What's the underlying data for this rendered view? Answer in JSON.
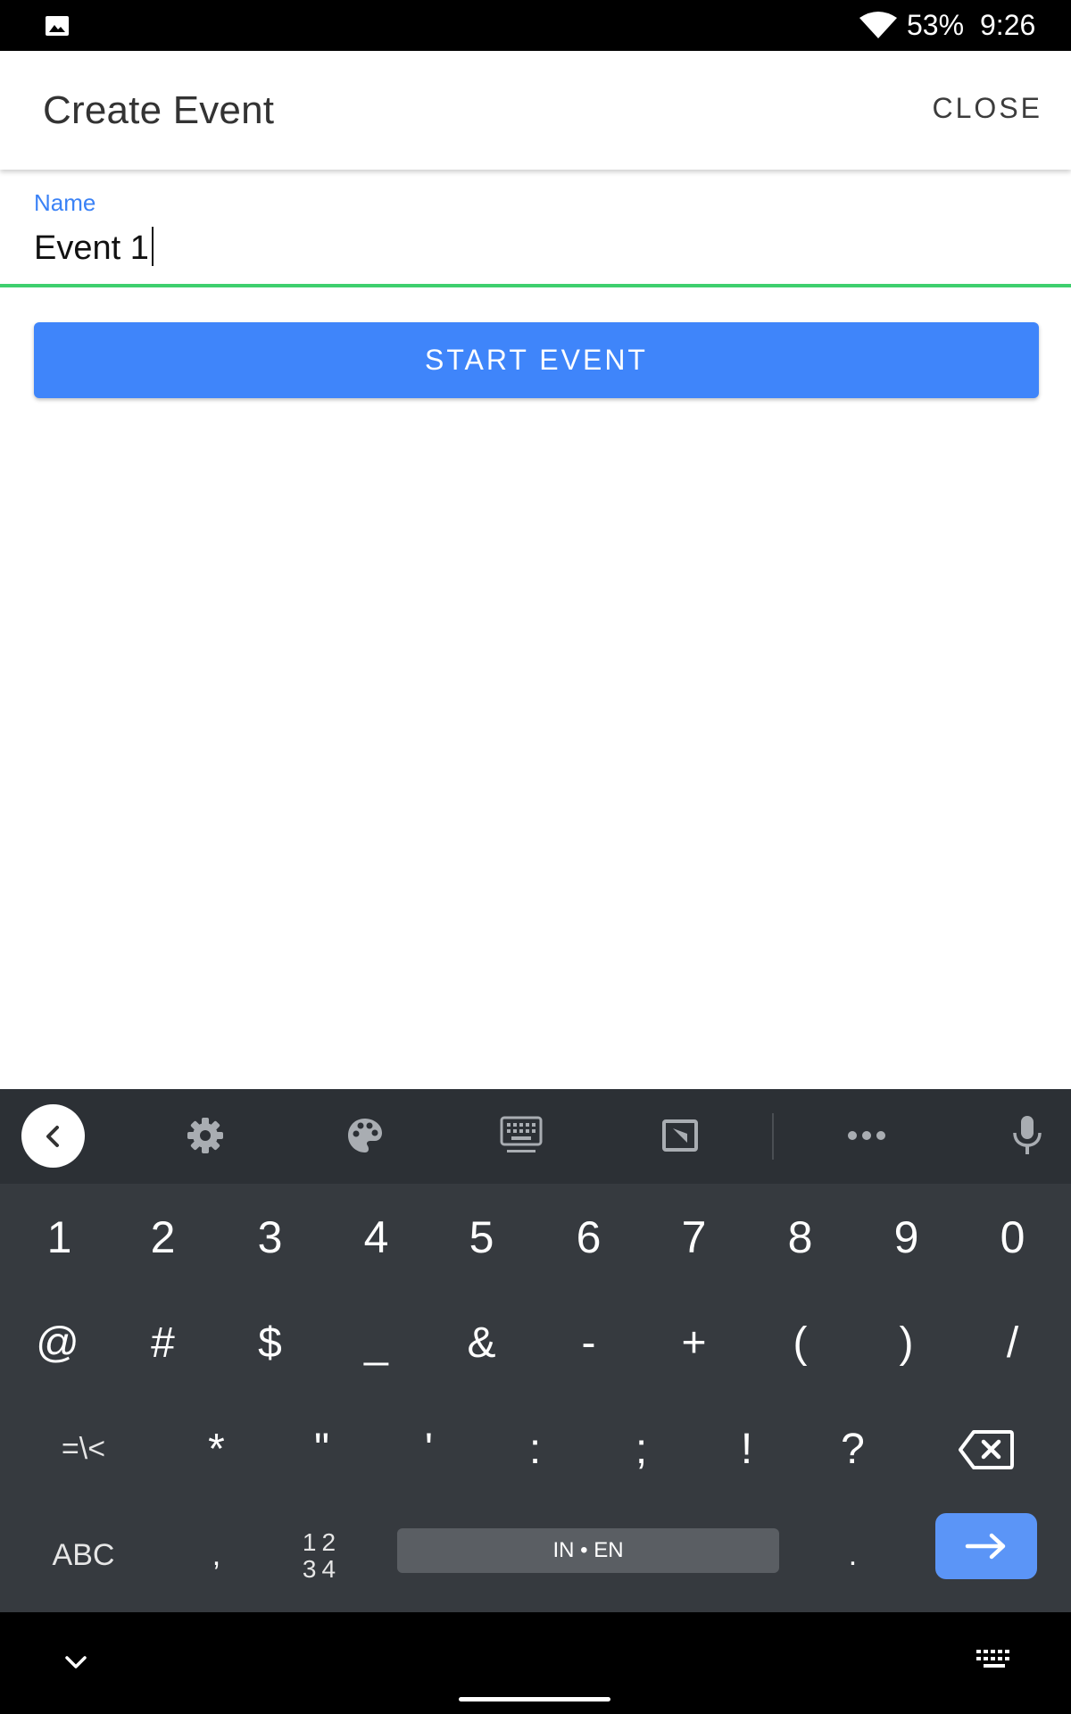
{
  "status_bar": {
    "battery": "53%",
    "time": "9:26",
    "icons": [
      "image-icon",
      "wifi-icon"
    ]
  },
  "app_bar": {
    "title": "Create Event",
    "close_label": "CLOSE"
  },
  "form": {
    "name_label": "Name",
    "name_value": "Event 1",
    "start_label": "START EVENT",
    "accent_color": "#3f85fa",
    "focus_color": "#3ecf6e"
  },
  "keyboard": {
    "toolbar": [
      "back-icon",
      "settings-icon",
      "palette-icon",
      "keyboard-mode-icon",
      "floating-keyboard-icon",
      "more-icon",
      "mic-icon"
    ],
    "row1": [
      "1",
      "2",
      "3",
      "4",
      "5",
      "6",
      "7",
      "8",
      "9",
      "0"
    ],
    "row2": [
      "@",
      "#",
      "$",
      "_",
      "&",
      "-",
      "+",
      "(",
      ")",
      "/"
    ],
    "row3": [
      "=\\<",
      "*",
      "\"",
      "'",
      ":",
      ";",
      "!",
      "?"
    ],
    "abc": "ABC",
    "comma": ",",
    "numpad_top": "12",
    "numpad_bottom": "34",
    "space": "IN • EN",
    "period": "."
  }
}
